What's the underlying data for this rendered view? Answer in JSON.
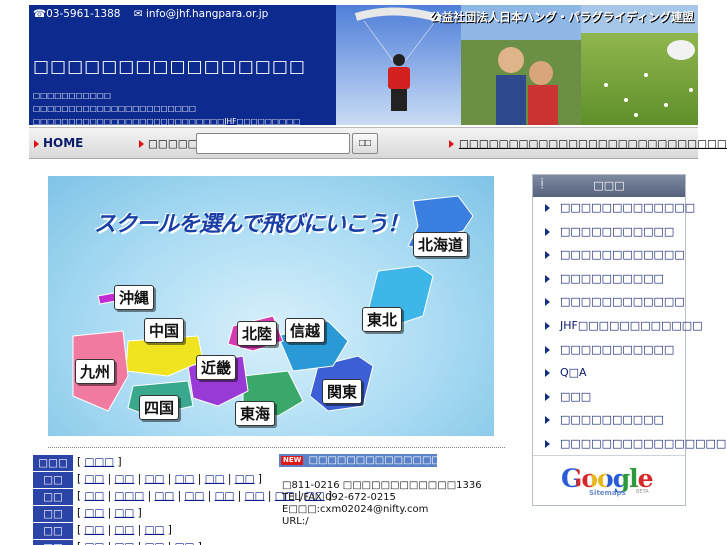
{
  "header": {
    "phone": "☎03-5961-1388",
    "email": "✉ info@jhf.hangpara.or.jp",
    "org_name": "公益社団法人日本ハング・パラグライディング連盟",
    "site_title": "□□□□□□□□□□□□□□□□",
    "sub_lines": [
      "□□□□□□□□□□□",
      "□□□□□□□□□□□□□□□□□□□□□□□",
      "□□□□□□□□□□□□□□□□□□□□□□□□□□□JHF□□□□□□□□□"
    ]
  },
  "navbar": {
    "home": "HOME",
    "search_label": "□□□□□□□",
    "search_value": "",
    "search_button": "□□",
    "assoc_link": "□□□□□□□□□□□□□□□□□□□□□□□□□□□(JHF)"
  },
  "map": {
    "heading": "スクールを選んで飛びにいこう！",
    "regions": {
      "hokkaido": "北海道",
      "tohoku": "東北",
      "kanto": "関東",
      "shinetsu": "信越",
      "hokuriku": "北陸",
      "tokai": "東海",
      "kinki": "近畿",
      "chugoku": "中国",
      "shikoku": "四国",
      "kyushu": "九州",
      "okinawa": "沖縄"
    }
  },
  "region_table": [
    {
      "head": "□□□",
      "links": [
        "□□□"
      ]
    },
    {
      "head": "□□",
      "links": [
        "□□",
        "□□",
        "□□",
        "□□",
        "□□",
        "□□"
      ]
    },
    {
      "head": "□□",
      "links": [
        "□□",
        "□□□",
        "□□",
        "□□",
        "□□",
        "□□",
        "□□",
        "□□"
      ]
    },
    {
      "head": "□□",
      "links": [
        "□□",
        "□□"
      ]
    },
    {
      "head": "□□",
      "links": [
        "□□",
        "□□",
        "□□"
      ]
    },
    {
      "head": "□□",
      "links": [
        "□□",
        "□□",
        "□□",
        "□□"
      ]
    }
  ],
  "news": {
    "badge": "NEW",
    "title": "□□□□□□□□□□□□□□□□□□□□",
    "lines": [
      "□811-0216 □□□□□□□□□□□□1336",
      "TEL/FAX 092-672-0215",
      "E□□□:cxm02024@nifty.com",
      "URL:/"
    ]
  },
  "sidebar": {
    "title": "□□□",
    "items": [
      "□□□□□□□□□□□□□",
      "□□□□□□□□□□□",
      "□□□□□□□□□□□□",
      "□□□□□□□□□□",
      "□□□□□□□□□□□□",
      "JHF□□□□□□□□□□□□",
      "□□□□□□□□□□□",
      "Q□A",
      "□□□",
      "□□□□□□□□□□",
      "□□□□□□□□□□□□□□□□"
    ],
    "google_logo": "Google",
    "google_sub": "Sitemaps",
    "google_beta": "BETA"
  },
  "colors": {
    "header_bg": "#0d2a8f",
    "table_head_bg": "#2b44a8",
    "news_head_bg": "#5b82c8",
    "accent_red": "#d11111"
  }
}
